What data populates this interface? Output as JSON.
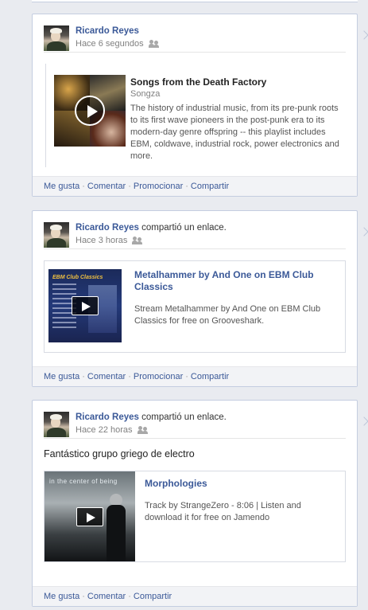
{
  "posts": [
    {
      "author": "Ricardo Reyes",
      "shared_text": "",
      "time": "Hace 6 segundos",
      "message": "",
      "attachment": {
        "title": "Songs from the Death Factory",
        "source": "Songza",
        "description": "The history of industrial music, from its pre-punk roots to its first wave pioneers in the post-punk era to its modern-day genre offspring -- this playlist includes EBM, coldwave, industrial rock, power electronics and more."
      },
      "actions": [
        "Me gusta",
        "Comentar",
        "Promocionar",
        "Compartir"
      ]
    },
    {
      "author": "Ricardo Reyes",
      "shared_text": "compartió un enlace.",
      "time": "Hace 3 horas",
      "message": "",
      "attachment": {
        "title": "Metalhammer by And One on EBM Club Classics",
        "source": "",
        "description": "Stream Metalhammer by And One on EBM Club Classics for free on Grooveshark.",
        "thumb_text": "EBM Club Classics"
      },
      "actions": [
        "Me gusta",
        "Comentar",
        "Promocionar",
        "Compartir"
      ]
    },
    {
      "author": "Ricardo Reyes",
      "shared_text": "compartió un enlace.",
      "time": "Hace 22 horas",
      "message": "Fantástico grupo griego de electro",
      "attachment": {
        "title": "Morphologies",
        "source": "",
        "description": "Track by StrangeZero - 8:06 | Listen and download it for free on Jamendo",
        "thumb_text": "in the center of being"
      },
      "actions": [
        "Me gusta",
        "Comentar",
        "Compartir"
      ]
    }
  ],
  "colors": {
    "link": "#3b5998",
    "background": "#e9ebf0",
    "border": "#c4cde0"
  }
}
